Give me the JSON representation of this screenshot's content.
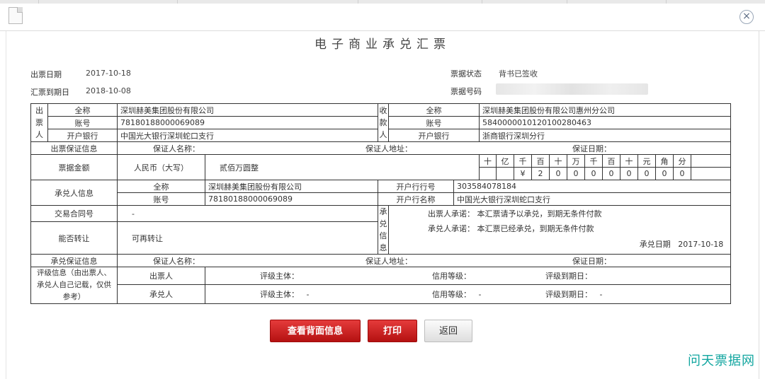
{
  "window": {
    "title": "电子商业承兑汇票",
    "close_symbol": "×"
  },
  "meta": {
    "issue_date_label": "出票日期",
    "issue_date": "2017-10-18",
    "due_date_label": "汇票到期日",
    "due_date": "2018-10-08",
    "status_label": "票据状态",
    "status": "背书已签收",
    "bill_no_label": "票据号码"
  },
  "drawer": {
    "side_label": [
      "出",
      "票",
      "人"
    ],
    "full_name_label": "全称",
    "full_name": "深圳赫美集团股份有限公司",
    "account_label": "账号",
    "account": "78180188000069089",
    "bank_label": "开户银行",
    "bank": "中国光大银行深圳蛇口支行"
  },
  "payee": {
    "side_label": [
      "收",
      "款",
      "人"
    ],
    "full_name_label": "全称",
    "full_name": "深圳赫美集团股份有限公司惠州分公司",
    "account_label": "账号",
    "account": "5840000010120100280463",
    "bank_label": "开户银行",
    "bank": "浙商银行深圳分行"
  },
  "drawer_guarantee": {
    "label": "出票保证信息",
    "name_label": "保证人名称：",
    "address_label": "保证人地址：",
    "date_label": "保证日期："
  },
  "amount": {
    "label": "票据金额",
    "currency_label": "人民币（大写）",
    "words": "贰佰万圆整",
    "units": [
      "十",
      "亿",
      "千",
      "百",
      "十",
      "万",
      "千",
      "百",
      "十",
      "元",
      "角",
      "分"
    ],
    "digits": [
      "",
      "",
      "¥",
      "2",
      "0",
      "0",
      "0",
      "0",
      "0",
      "0",
      "0",
      "0"
    ]
  },
  "acceptor": {
    "label": "承兑人信息",
    "full_name_label": "全称",
    "full_name": "深圳赫美集团股份有限公司",
    "account_label": "账号",
    "account": "78180188000069089",
    "bank_no_label": "开户行行号",
    "bank_no": "303584078184",
    "bank_name_label": "开户行名称",
    "bank_name": "中国光大银行深圳蛇口支行"
  },
  "contract": {
    "label": "交易合同号",
    "value": "-"
  },
  "transferable": {
    "label": "能否转让",
    "value": "可再转让"
  },
  "acceptance_info": {
    "side_label": [
      "承",
      "兑",
      "信",
      "息"
    ],
    "drawer_promise_label": "出票人承诺：",
    "drawer_promise": "本汇票请予以承兑，到期无条件付款",
    "acceptor_promise_label": "承兑人承诺：",
    "acceptor_promise": "本汇票已经承兑，到期无条件付款",
    "accept_date_label": "承兑日期",
    "accept_date": "2017-10-18"
  },
  "acceptance_guarantee": {
    "label": "承兑保证信息",
    "name_label": "保证人名称：",
    "address_label": "保证人地址：",
    "date_label": "保证日期："
  },
  "rating": {
    "label": "评级信息（由出票人、承兑人自己记载，仅供参考）",
    "rows": [
      {
        "party": "出票人",
        "subject_label": "评级主体：",
        "subject": "",
        "grade_label": "信用等级：",
        "grade": "",
        "expiry_label": "评级到期日：",
        "expiry": ""
      },
      {
        "party": "承兑人",
        "subject_label": "评级主体：",
        "subject": "-",
        "grade_label": "信用等级：",
        "grade": "-",
        "expiry_label": "评级到期日：",
        "expiry": "-"
      }
    ]
  },
  "buttons": {
    "back_info": "查看背面信息",
    "print": "打印",
    "return": "返回"
  },
  "watermark": "问天票据网",
  "colors": {
    "primary_button": "#c81a1a",
    "watermark": "#12a6a0"
  }
}
